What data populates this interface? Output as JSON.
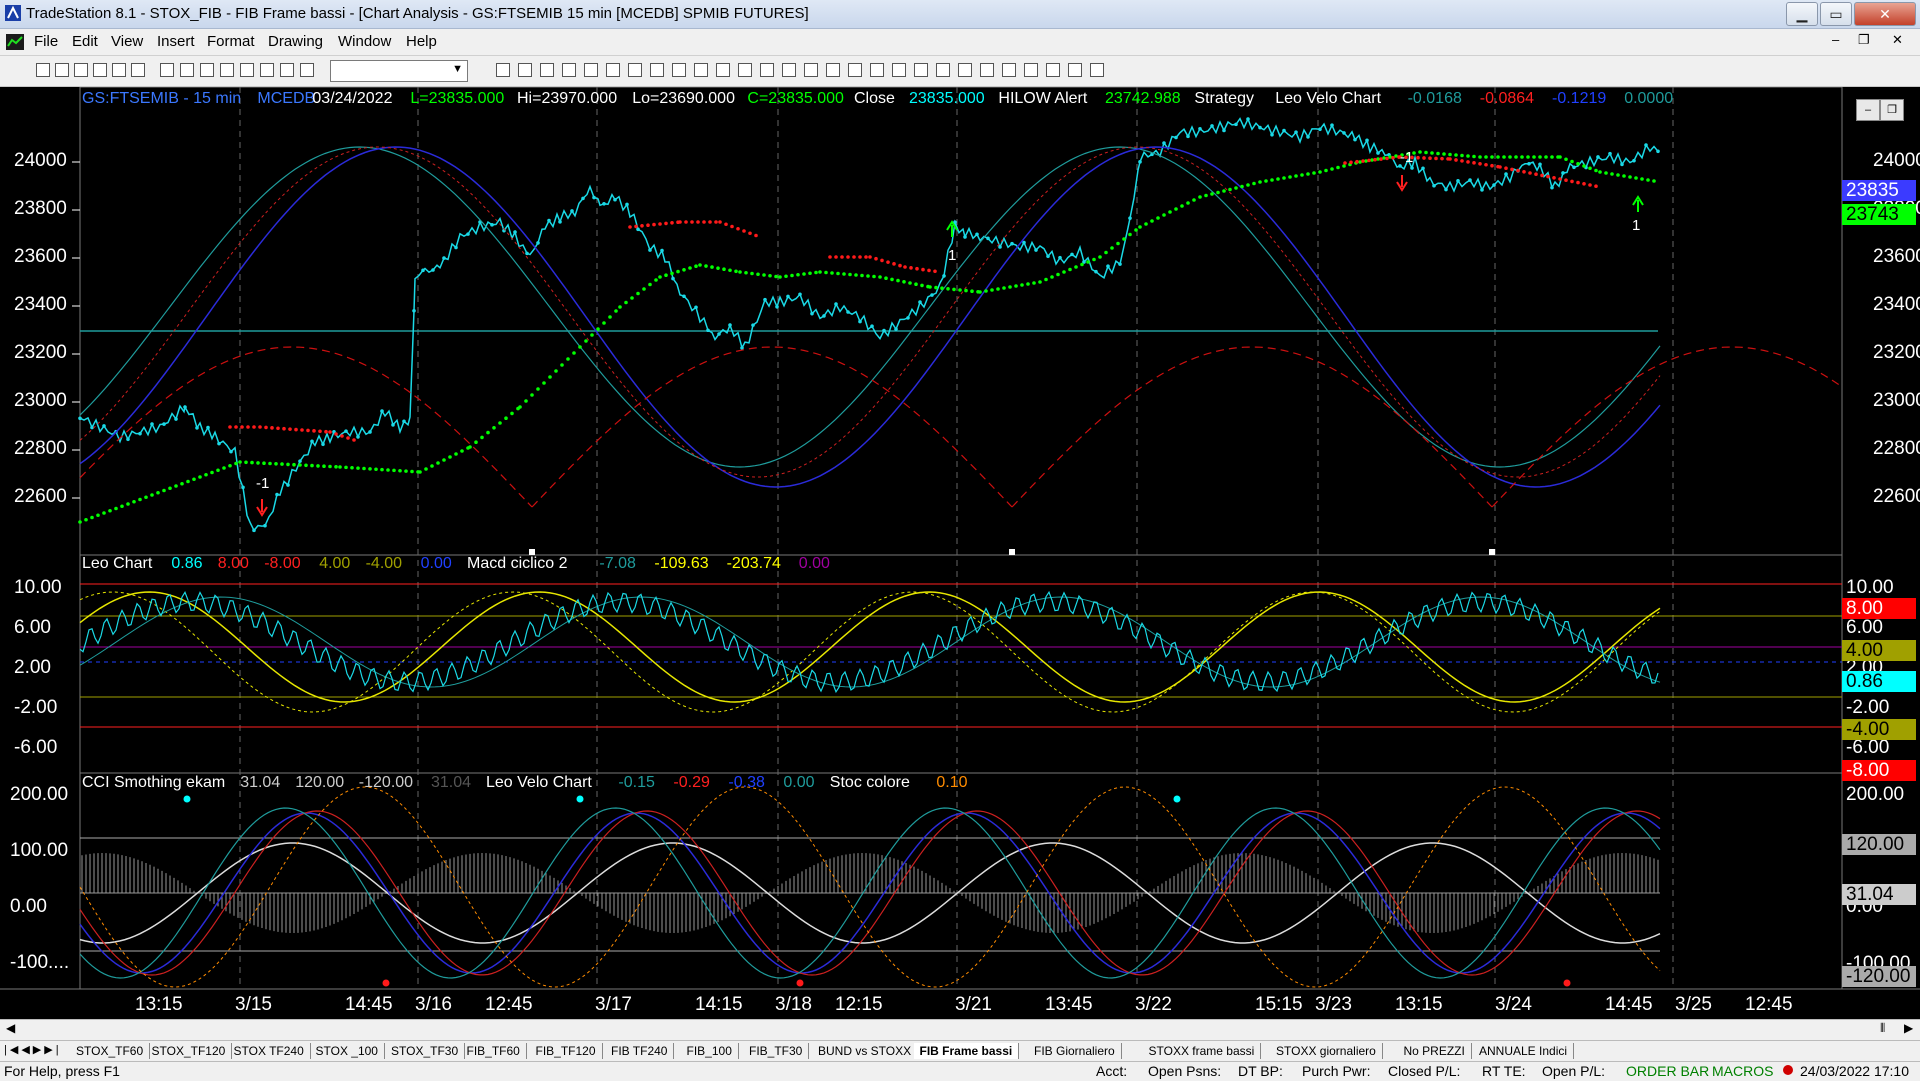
{
  "window": {
    "title": "TradeStation 8.1 - STOX_FIB - FIB Frame bassi - [Chart Analysis - GS:FTSEMIB  15 min  [MCEDB] SPMIB FUTURES]",
    "min_label": "▁",
    "max_label": "▭",
    "close_label": "✕",
    "child_min": "–",
    "child_restore": "❐",
    "child_close": "✕"
  },
  "menu": [
    "File",
    "Edit",
    "View",
    "Insert",
    "Format",
    "Drawing",
    "Window",
    "Help"
  ],
  "price_header": [
    {
      "text": "GS:FTSEMIB - 15 min",
      "color": "#3b78ff"
    },
    {
      "text": "MCEDB",
      "color": "#3b78ff"
    },
    {
      "text": "03/24/2022",
      "color": "#ffffff"
    },
    {
      "text": "L=23835.000",
      "color": "#00ff00"
    },
    {
      "text": "Hi=23970.000",
      "color": "#ffffff"
    },
    {
      "text": "Lo=23690.000",
      "color": "#ffffff"
    },
    {
      "text": "C=23835.000",
      "color": "#00ff00"
    },
    {
      "text": "Close",
      "color": "#ffffff"
    },
    {
      "text": "23835.000",
      "color": "#00ffff"
    },
    {
      "text": "HILOW Alert",
      "color": "#ffffff"
    },
    {
      "text": "23742.988",
      "color": "#00ff00"
    },
    {
      "text": "Strategy",
      "color": "#ffffff"
    },
    {
      "text": "Leo Velo Chart",
      "color": "#ffffff"
    },
    {
      "text": "-0.0168",
      "color": "#1f9c9c"
    },
    {
      "text": "-0.0864",
      "color": "#ff2020"
    },
    {
      "text": "-0.1219",
      "color": "#2040ff"
    },
    {
      "text": "0.0000",
      "color": "#1f9c9c"
    }
  ],
  "macd_header": [
    {
      "text": "Leo Chart",
      "color": "#ffffff"
    },
    {
      "text": "0.86",
      "color": "#00ffff"
    },
    {
      "text": "8.00",
      "color": "#ff2020"
    },
    {
      "text": "-8.00",
      "color": "#ff2020"
    },
    {
      "text": "4.00",
      "color": "#a0a000"
    },
    {
      "text": "-4.00",
      "color": "#a0a000"
    },
    {
      "text": "0.00",
      "color": "#2040ff"
    },
    {
      "text": "Macd ciclico 2",
      "color": "#ffffff"
    },
    {
      "text": "-7.08",
      "color": "#1f9c9c"
    },
    {
      "text": "-109.63",
      "color": "#ffff00"
    },
    {
      "text": "-203.74",
      "color": "#ffff00"
    },
    {
      "text": "0.00",
      "color": "#a000a0"
    }
  ],
  "cci_header": [
    {
      "text": "CCI Smothing ekam",
      "color": "#ffffff"
    },
    {
      "text": "31.04",
      "color": "#cccccc"
    },
    {
      "text": "120.00",
      "color": "#cccccc"
    },
    {
      "text": "-120.00",
      "color": "#cccccc"
    },
    {
      "text": "31.04",
      "color": "#555555"
    },
    {
      "text": "Leo Velo Chart",
      "color": "#ffffff"
    },
    {
      "text": "-0.15",
      "color": "#1f9c9c"
    },
    {
      "text": "-0.29",
      "color": "#ff2020"
    },
    {
      "text": "-0.38",
      "color": "#2040ff"
    },
    {
      "text": "0.00",
      "color": "#1f9c9c"
    },
    {
      "text": "Stoc colore",
      "color": "#ffffff"
    },
    {
      "text": "0.10",
      "color": "#ff8c00"
    }
  ],
  "price_axis": [
    "24000",
    "23800",
    "23600",
    "23400",
    "23200",
    "23000",
    "22800",
    "22600"
  ],
  "macd_axis": [
    "10.00",
    "6.00",
    "2.00",
    "-2.00",
    "-6.00"
  ],
  "macd_axis_right": [
    "10.00",
    "6.00",
    "2.00",
    "-2.00",
    "-6.00"
  ],
  "cci_axis": [
    "200.00",
    "100.00",
    "0.00",
    "-100...."
  ],
  "cci_axis_right": [
    "200.00",
    "0.00",
    "-100.00"
  ],
  "price_tags": [
    {
      "text": "23835",
      "bg": "#3b3bff",
      "fg": "#ffffff"
    },
    {
      "text": "23743",
      "bg": "#00ff00",
      "fg": "#000000"
    }
  ],
  "macd_tags": [
    {
      "text": "8.00",
      "bg": "#ff0000",
      "fg": "#ffffff"
    },
    {
      "text": "4.00",
      "bg": "#a0a000",
      "fg": "#000000"
    },
    {
      "text": "0.86",
      "bg": "#00ffff",
      "fg": "#000000"
    },
    {
      "text": "-4.00",
      "bg": "#a0a000",
      "fg": "#000000"
    },
    {
      "text": "-8.00",
      "bg": "#ff0000",
      "fg": "#ffffff"
    }
  ],
  "cci_tags": [
    {
      "text": "120.00",
      "bg": "#aaaaaa",
      "fg": "#000000"
    },
    {
      "text": "31.04",
      "bg": "#cccccc",
      "fg": "#000000"
    },
    {
      "text": "-120.00",
      "bg": "#aaaaaa",
      "fg": "#000000"
    }
  ],
  "signal_labels": [
    "-1",
    "1",
    "-1",
    "1"
  ],
  "time_axis": [
    "13:15",
    "3/15",
    "14:45",
    "3/16",
    "12:45",
    "3/17",
    "14:15",
    "3/18",
    "12:15",
    "3/21",
    "13:45",
    "3/22",
    "15:15",
    "3/23",
    "13:15",
    "3/24",
    "14:45",
    "3/25",
    "12:45"
  ],
  "sheet_tabs": [
    "STOX_TF60",
    "STOX_TF120",
    "STOX TF240",
    "STOX _100",
    "STOX_TF30",
    "FIB_TF60",
    "FIB_TF120",
    "FIB TF240",
    "FIB_100",
    "FIB_TF30",
    "BUND vs STOXX",
    "FIB Frame bassi",
    "FIB Giornaliero",
    "STOXX frame bassi",
    "STOXX giornaliero",
    "No PREZZI",
    "ANNUALE Indici"
  ],
  "active_tab": "FIB Frame bassi",
  "status": {
    "help": "For Help, press F1",
    "acct": "Acct:",
    "open_psns": "Open Psns:",
    "dt_bp": "DT BP:",
    "purch_pwr": "Purch Pwr:",
    "closed_pl": "Closed P/L:",
    "rt_te": "RT TE:",
    "open_pl": "Open P/L:",
    "order_bar": "ORDER BAR",
    "macros": "MACROS",
    "datetime": "24/03/2022 17:10"
  },
  "colors": {
    "price_line": "#1ad9e6",
    "bull_dots": "#00ff00",
    "bear_dots": "#ff1a1a",
    "blue_osc": "#2b2bd9",
    "red_osc": "#cc2020",
    "teal_osc": "#1f9c9c",
    "yellow": "#e6e600",
    "grid_red": "#ff2020"
  }
}
